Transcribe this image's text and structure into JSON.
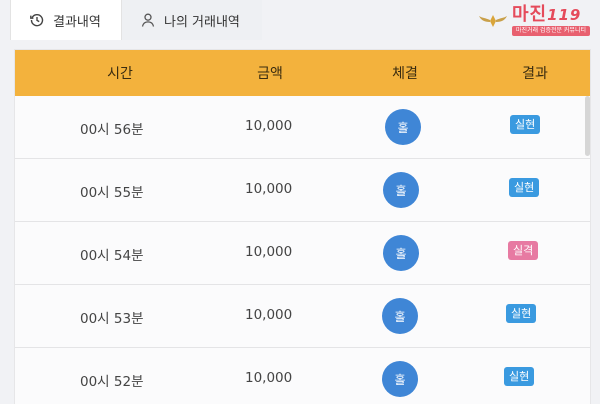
{
  "tabs": [
    {
      "label": "결과내역",
      "icon": "history-icon",
      "active": true
    },
    {
      "label": "나의 거래내역",
      "icon": "user-icon",
      "active": false
    }
  ],
  "logo": {
    "main": "마진",
    "suffix": "119",
    "sub": "마진거래 검증전문 커뮤니티"
  },
  "table": {
    "headers": {
      "time": "시간",
      "amount": "금액",
      "bet": "체결",
      "result": "결과"
    },
    "rows": [
      {
        "time": "00시 56분",
        "amount": "10,000",
        "bet": "홀",
        "result": "실현",
        "result_color": "#3a9ae0"
      },
      {
        "time": "00시 55분",
        "amount": "10,000",
        "bet": "홀",
        "result": "실현",
        "result_color": "#3a9ae0"
      },
      {
        "time": "00시 54분",
        "amount": "10,000",
        "bet": "홀",
        "result": "실격",
        "result_color": "#e77aa2"
      },
      {
        "time": "00시 53분",
        "amount": "10,000",
        "bet": "홀",
        "result": "실현",
        "result_color": "#3a9ae0"
      },
      {
        "time": "00시 52분",
        "amount": "10,000",
        "bet": "홀",
        "result": "실현",
        "result_color": "#3a9ae0"
      }
    ]
  },
  "colors": {
    "header_bg": "#f3b23d",
    "bet_circle": "#3f86d6"
  }
}
